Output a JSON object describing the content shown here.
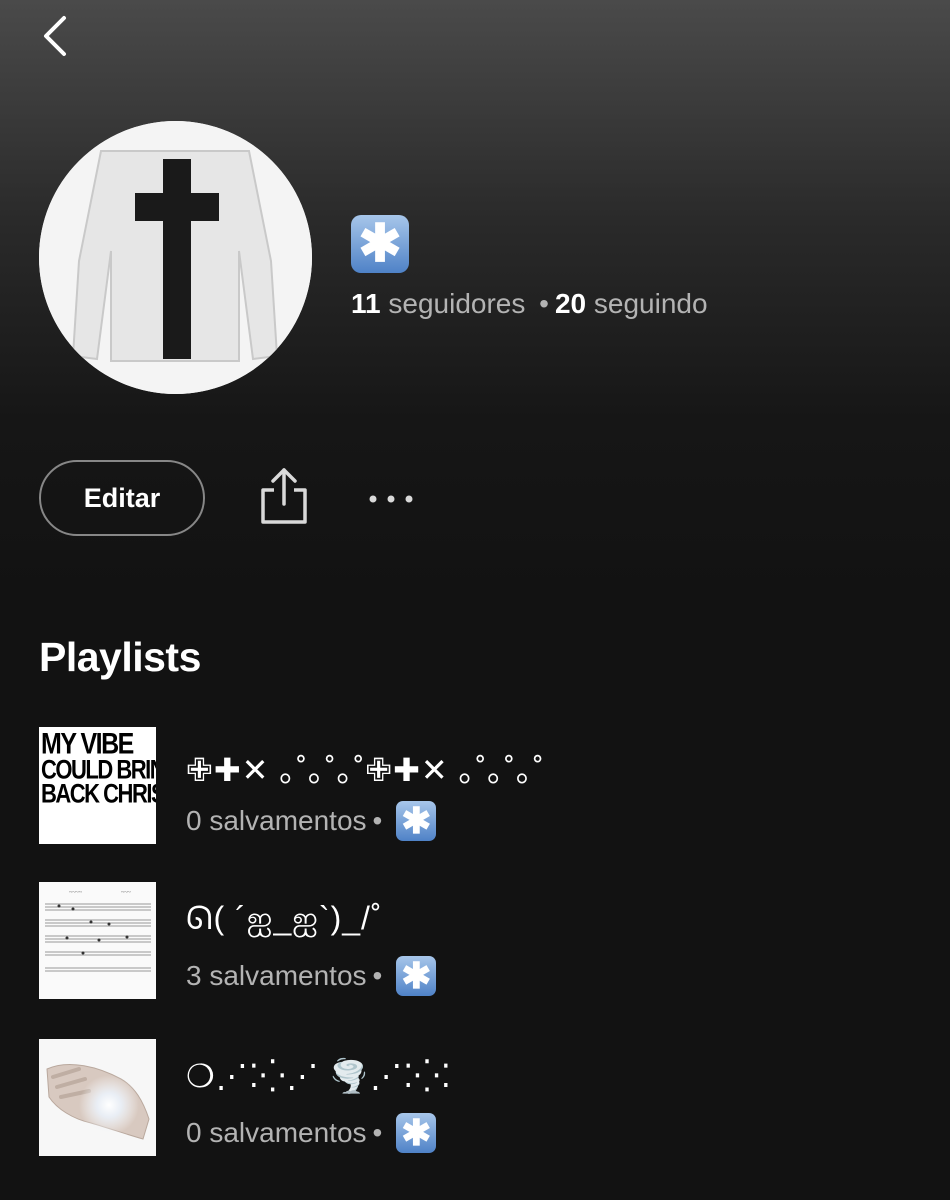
{
  "nav": {
    "back_icon": "chevron-left-icon"
  },
  "profile": {
    "name_badge": "✱",
    "followers_count": "11",
    "followers_label": "seguidores",
    "separator": "•",
    "following_count": "20",
    "following_label": "seguindo"
  },
  "actions": {
    "edit_label": "Editar",
    "share_icon": "share-icon",
    "more_icon": "more-horizontal-icon"
  },
  "playlists": {
    "heading": "Playlists",
    "items": [
      {
        "title": "✙✚✕ ｡˚｡˚｡˚✙✚✕ ｡˚｡˚｡˚",
        "saves": "0 salvamentos",
        "badge": "✱",
        "cover_text": [
          "MY VIBE",
          "COULD BRING",
          "BACK CHRIST"
        ]
      },
      {
        "title": "ᘏ( ´ஐ_ஐ`)_/˚",
        "saves": "3 salvamentos",
        "badge": "✱"
      },
      {
        "title": "❍⋰⁚⁛⋰ 🌪️⋰⁚⁛⁚",
        "saves": "0 salvamentos",
        "badge": "✱"
      }
    ]
  },
  "colors": {
    "background": "#121212",
    "secondary_text": "#b3b3b3",
    "badge_blue": "#4f82c7"
  }
}
